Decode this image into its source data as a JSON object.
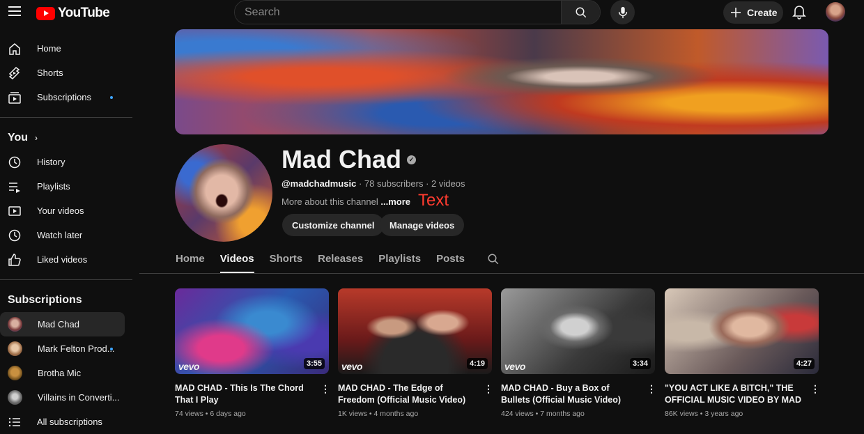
{
  "header": {
    "logo_text": "YouTube",
    "search_placeholder": "Search",
    "create_label": "Create"
  },
  "sidebar": {
    "main": [
      {
        "label": "Home",
        "icon": "home-icon"
      },
      {
        "label": "Shorts",
        "icon": "shorts-icon"
      },
      {
        "label": "Subscriptions",
        "icon": "subscriptions-icon"
      }
    ],
    "you_title": "You",
    "you": [
      {
        "label": "History",
        "icon": "history-icon"
      },
      {
        "label": "Playlists",
        "icon": "playlists-icon"
      },
      {
        "label": "Your videos",
        "icon": "your-videos-icon"
      },
      {
        "label": "Watch later",
        "icon": "watch-later-icon"
      },
      {
        "label": "Liked videos",
        "icon": "liked-videos-icon"
      }
    ],
    "subs_title": "Subscriptions",
    "subs": [
      {
        "label": "Mad Chad"
      },
      {
        "label": "Mark Felton Prod..."
      },
      {
        "label": "Brotha Mic"
      },
      {
        "label": "Villains in Converti..."
      },
      {
        "label": "All subscriptions"
      }
    ]
  },
  "channel": {
    "name": "Mad Chad",
    "handle": "@madchadmusic",
    "subscribers": "78 subscribers",
    "videos_count": "2 videos",
    "about": "More about this channel",
    "more": "...more",
    "annotation": "Text",
    "customize_label": "Customize channel",
    "manage_label": "Manage videos"
  },
  "tabs": [
    "Home",
    "Videos",
    "Shorts",
    "Releases",
    "Playlists",
    "Posts"
  ],
  "videos": [
    {
      "title": "MAD CHAD - This Is The Chord That I Play",
      "views": "74 views",
      "age": "6 days ago",
      "duration": "3:55",
      "vevo": "vevo"
    },
    {
      "title": "MAD CHAD - The Edge of Freedom (Official Music Video)",
      "views": "1K views",
      "age": "4 months ago",
      "duration": "4:19",
      "vevo": "vevo"
    },
    {
      "title": "MAD CHAD - Buy a Box of Bullets (Official Music Video)",
      "views": "424 views",
      "age": "7 months ago",
      "duration": "3:34",
      "vevo": "vevo"
    },
    {
      "title": "\"YOU ACT LIKE A BITCH,\" THE OFFICIAL MUSIC VIDEO BY MAD CHAD",
      "views": "86K views",
      "age": "3 years ago",
      "duration": "4:27",
      "vevo": ""
    }
  ]
}
